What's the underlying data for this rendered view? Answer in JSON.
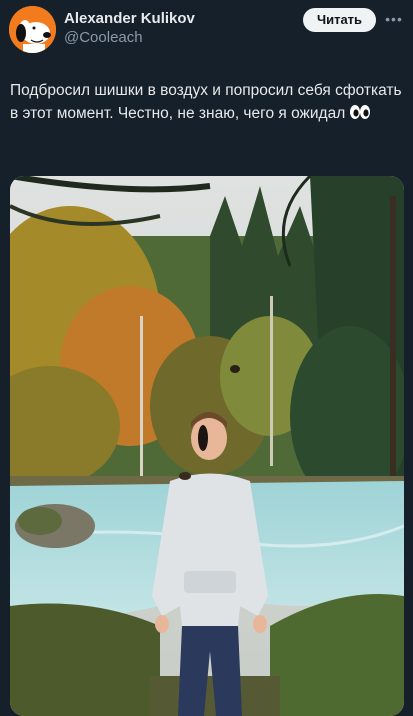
{
  "author": {
    "display_name": "Alexander Kulikov",
    "handle": "@Cooleach",
    "avatar_icon": "snoopy-avatar-icon"
  },
  "follow_button": {
    "label": "Читать"
  },
  "more_icon": "more-icon",
  "tweet": {
    "text": "Подбросил шишки в воздух и попросил себя сфоткать в этот момент. Честно, не знаю, чего я ожидал",
    "emoji": "eyes-emoji"
  },
  "media": {
    "type": "photo",
    "description_icon": "photo-forest-river"
  },
  "colors": {
    "background": "#15202b",
    "text_primary": "#e7e9ea",
    "text_secondary": "#8b98a5",
    "button_bg": "#eff3f4",
    "avatar_bg": "#f27b1d"
  }
}
